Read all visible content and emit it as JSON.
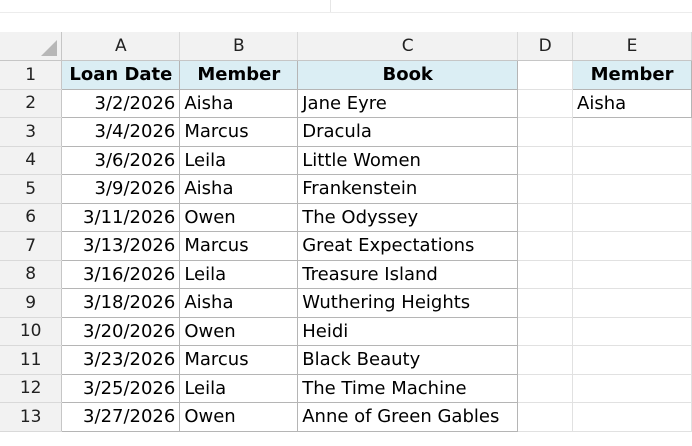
{
  "columns": [
    "A",
    "B",
    "C",
    "D",
    "E"
  ],
  "headers": {
    "loan_date": "Loan Date",
    "member": "Member",
    "book": "Book",
    "lookup_member": "Member"
  },
  "lookup_value": "Aisha",
  "rows": [
    {
      "num": "1"
    },
    {
      "num": "2",
      "date": "3/2/2026",
      "member": "Aisha",
      "book": "Jane Eyre"
    },
    {
      "num": "3",
      "date": "3/4/2026",
      "member": "Marcus",
      "book": "Dracula"
    },
    {
      "num": "4",
      "date": "3/6/2026",
      "member": "Leila",
      "book": "Little Women"
    },
    {
      "num": "5",
      "date": "3/9/2026",
      "member": "Aisha",
      "book": "Frankenstein"
    },
    {
      "num": "6",
      "date": "3/11/2026",
      "member": "Owen",
      "book": "The Odyssey"
    },
    {
      "num": "7",
      "date": "3/13/2026",
      "member": "Marcus",
      "book": "Great Expectations"
    },
    {
      "num": "8",
      "date": "3/16/2026",
      "member": "Leila",
      "book": "Treasure Island"
    },
    {
      "num": "9",
      "date": "3/18/2026",
      "member": "Aisha",
      "book": "Wuthering Heights"
    },
    {
      "num": "10",
      "date": "3/20/2026",
      "member": "Owen",
      "book": "Heidi"
    },
    {
      "num": "11",
      "date": "3/23/2026",
      "member": "Marcus",
      "book": "Black Beauty"
    },
    {
      "num": "12",
      "date": "3/25/2026",
      "member": "Leila",
      "book": "The Time Machine"
    },
    {
      "num": "13",
      "date": "3/27/2026",
      "member": "Owen",
      "book": "Anne of Green Gables"
    }
  ],
  "colors": {
    "header_fill": "#dbeef4",
    "grid_header_fill": "#f2f2f2"
  }
}
